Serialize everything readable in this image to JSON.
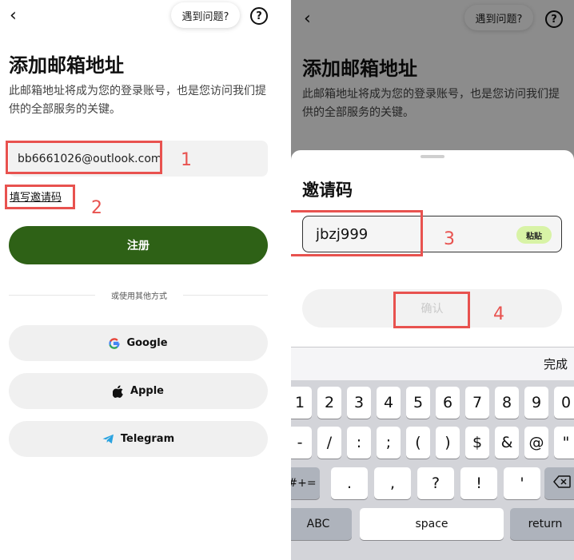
{
  "left": {
    "help_label": "遇到问题?",
    "help_icon": "question-circle-icon",
    "title": "添加邮箱地址",
    "description": "此邮箱地址将成为您的登录账号，也是您访问我们提供的全部服务的关键。",
    "email_value": "bb6661026@outlook.com",
    "invite_link": "填写邀请码",
    "register_label": "注册",
    "divider_label": "或使用其他方式",
    "social": [
      {
        "label": "Google",
        "icon": "google-icon"
      },
      {
        "label": "Apple",
        "icon": "apple-icon"
      },
      {
        "label": "Telegram",
        "icon": "telegram-icon"
      }
    ],
    "annotations": [
      "1",
      "2"
    ]
  },
  "right": {
    "help_label": "遇到问题?",
    "title": "添加邮箱地址",
    "description": "此邮箱地址将成为您的登录账号，也是您访问我们提供的全部服务的关键。",
    "sheet_title": "邀请码",
    "code_value": "jbzj999",
    "paste_label": "粘贴",
    "confirm_label": "确认",
    "done_label": "完成",
    "annotations": [
      "3",
      "4"
    ],
    "keyboard": {
      "row1": [
        "1",
        "2",
        "3",
        "4",
        "5",
        "6",
        "7",
        "8",
        "9",
        "0"
      ],
      "row2": [
        "-",
        "/",
        ":",
        ";",
        "(",
        ")",
        "$",
        "&",
        "@",
        "\""
      ],
      "row3_mode": "#+=",
      "row3": [
        ".",
        ",",
        "?",
        "!",
        "'"
      ],
      "abc": "ABC",
      "space": "space",
      "return": "return"
    }
  },
  "colors": {
    "brand_green": "#2e6116",
    "paste_bg": "#d8f3a6",
    "annotation": "#e8524f"
  }
}
